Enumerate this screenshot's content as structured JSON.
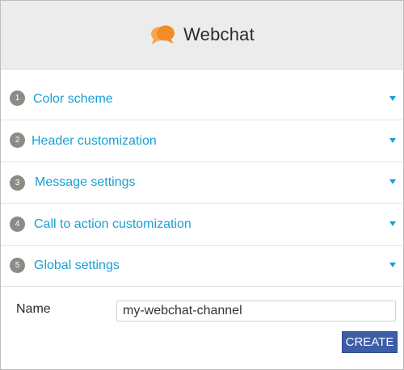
{
  "header": {
    "title": "Webchat",
    "icon": "chat-bubbles-icon",
    "icon_color": "#f28c28"
  },
  "sections": [
    {
      "number": "1",
      "label": "Color scheme"
    },
    {
      "number": "2",
      "label": "Header customization"
    },
    {
      "number": "3",
      "label": "Message settings"
    },
    {
      "number": "4",
      "label": "Call to action customization"
    },
    {
      "number": "5",
      "label": "Global settings"
    }
  ],
  "form": {
    "name_label": "Name",
    "name_value": "my-webchat-channel",
    "create_label": "CREATE"
  },
  "colors": {
    "accent": "#1a9fd6",
    "button": "#3c5da8",
    "badge": "#8d8b85",
    "header_bg": "#ececec"
  }
}
